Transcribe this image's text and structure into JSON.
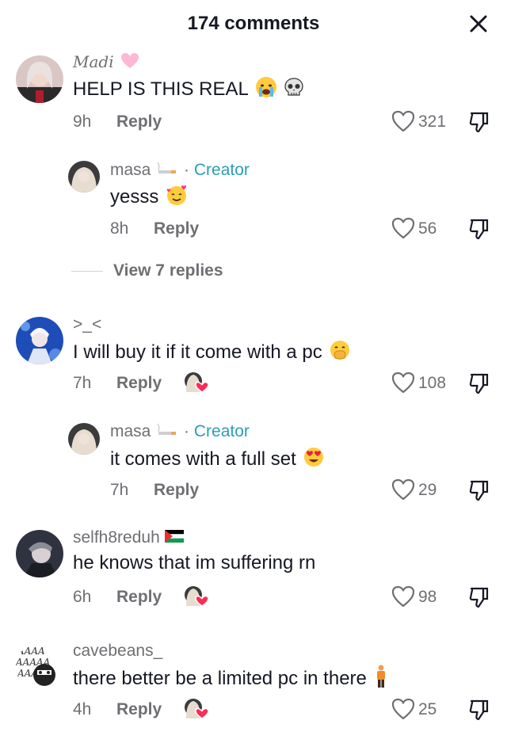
{
  "header": {
    "title": "174 comments"
  },
  "comments": [
    {
      "username": "Madi",
      "text": "HELP IS THIS REAL",
      "time": "9h",
      "reply_label": "Reply",
      "likes": "321"
    },
    {
      "username": "masa",
      "creator_label": "Creator",
      "text": "yesss",
      "time": "8h",
      "reply_label": "Reply",
      "likes": "56"
    },
    {
      "view_replies": "View 7 replies"
    },
    {
      "username": ">_<",
      "text": "I will buy it if it come with a pc",
      "time": "7h",
      "reply_label": "Reply",
      "likes": "108"
    },
    {
      "username": "masa",
      "creator_label": "Creator",
      "text": "it comes with a full set",
      "time": "7h",
      "reply_label": "Reply",
      "likes": "29"
    },
    {
      "username": "selfh8reduh",
      "text": "he knows that im suffering rn",
      "time": "6h",
      "reply_label": "Reply",
      "likes": "98"
    },
    {
      "username": "cavebeans_",
      "text": "there better be a limited pc in there",
      "time": "4h",
      "reply_label": "Reply",
      "likes": "25"
    }
  ],
  "icons": {
    "close": "close-icon",
    "like": "heart-outline-icon",
    "dislike": "thumbs-down-icon",
    "creator_liked": "creator-liked-heart-icon"
  },
  "colors": {
    "creator": "#2a9fb2",
    "muted": "#6e6f73",
    "text": "#161823",
    "like_heart": "#fe2c55"
  }
}
